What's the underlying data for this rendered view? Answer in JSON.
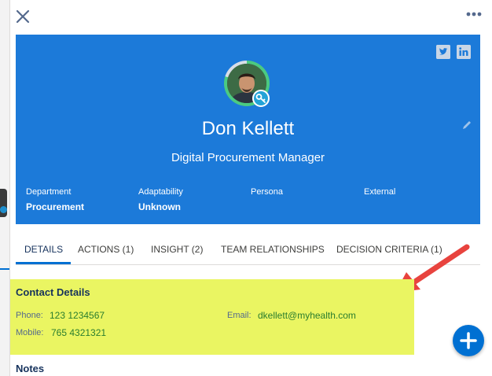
{
  "profile": {
    "name": "Don Kellett",
    "title": "Digital Procurement Manager",
    "fields": [
      {
        "label": "Department",
        "value": "Procurement"
      },
      {
        "label": "Adaptability",
        "value": "Unknown"
      },
      {
        "label": "Persona",
        "value": ""
      },
      {
        "label": "External",
        "value": ""
      }
    ],
    "social": {
      "twitter": "t",
      "linkedin": "in"
    },
    "brand_color": "#1c7ad9"
  },
  "tabs": [
    {
      "label": "DETAILS"
    },
    {
      "label": "ACTIONS (1)"
    },
    {
      "label": "INSIGHT (2)"
    },
    {
      "label": "TEAM RELATIONSHIPS"
    },
    {
      "label": "DECISION CRITERIA (1)"
    }
  ],
  "contact": {
    "section_title": "Contact Details",
    "phone_label": "Phone:",
    "phone": "123 1234567",
    "mobile_label": "Mobile:",
    "mobile": "765 4321321",
    "email_label": "Email:",
    "email": "dkellett@myhealth.com",
    "highlight_color": "#eaf562"
  },
  "notes": {
    "section_title": "Notes"
  },
  "annotation": {
    "arrow_color": "#e8433e"
  }
}
